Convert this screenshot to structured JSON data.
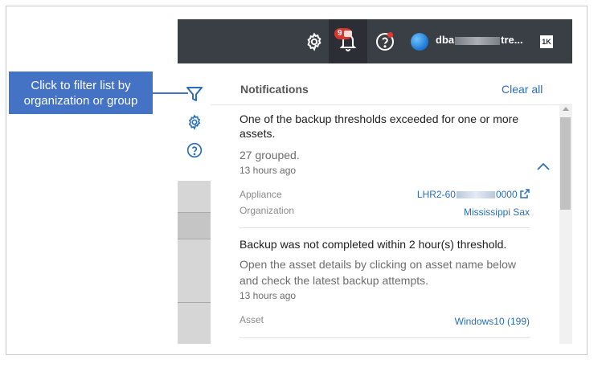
{
  "callout": {
    "text": "Click to filter list by organization or group"
  },
  "topbar": {
    "badge_count": "9",
    "user_prefix": "dba",
    "user_suffix": "tre...",
    "logo_text": "1K"
  },
  "icons": {
    "gear": "gear-icon",
    "bell": "bell-icon",
    "help": "help-circle-icon",
    "filter": "filter-icon",
    "settings": "gear-icon",
    "side_help": "help-circle-icon",
    "collapse": "chevron-up-icon",
    "external": "external-link-icon"
  },
  "notifications": {
    "title": "Notifications",
    "clear_all": "Clear all",
    "items": [
      {
        "title": "One of the backup thresholds exceeded for one or more assets.",
        "subtitle": "27 grouped.",
        "time": "13 hours ago",
        "fields": [
          {
            "label": "Appliance",
            "value_prefix": "LHR2-60",
            "value_suffix": "0000"
          },
          {
            "label": "Organization",
            "value": "Mississippi Sax"
          }
        ]
      },
      {
        "title": "Backup was not completed within 2 hour(s) threshold.",
        "subtitle": "Open the asset details by clicking on asset name below and check the latest backup attempts.",
        "time": "13 hours ago",
        "fields": [
          {
            "label": "Asset",
            "value": "Windows10 (199)"
          }
        ]
      }
    ]
  },
  "colors": {
    "topbar": "#3a3f46",
    "accent": "#2a6ebb",
    "callout": "#4472c4",
    "badge": "#d9352f"
  }
}
